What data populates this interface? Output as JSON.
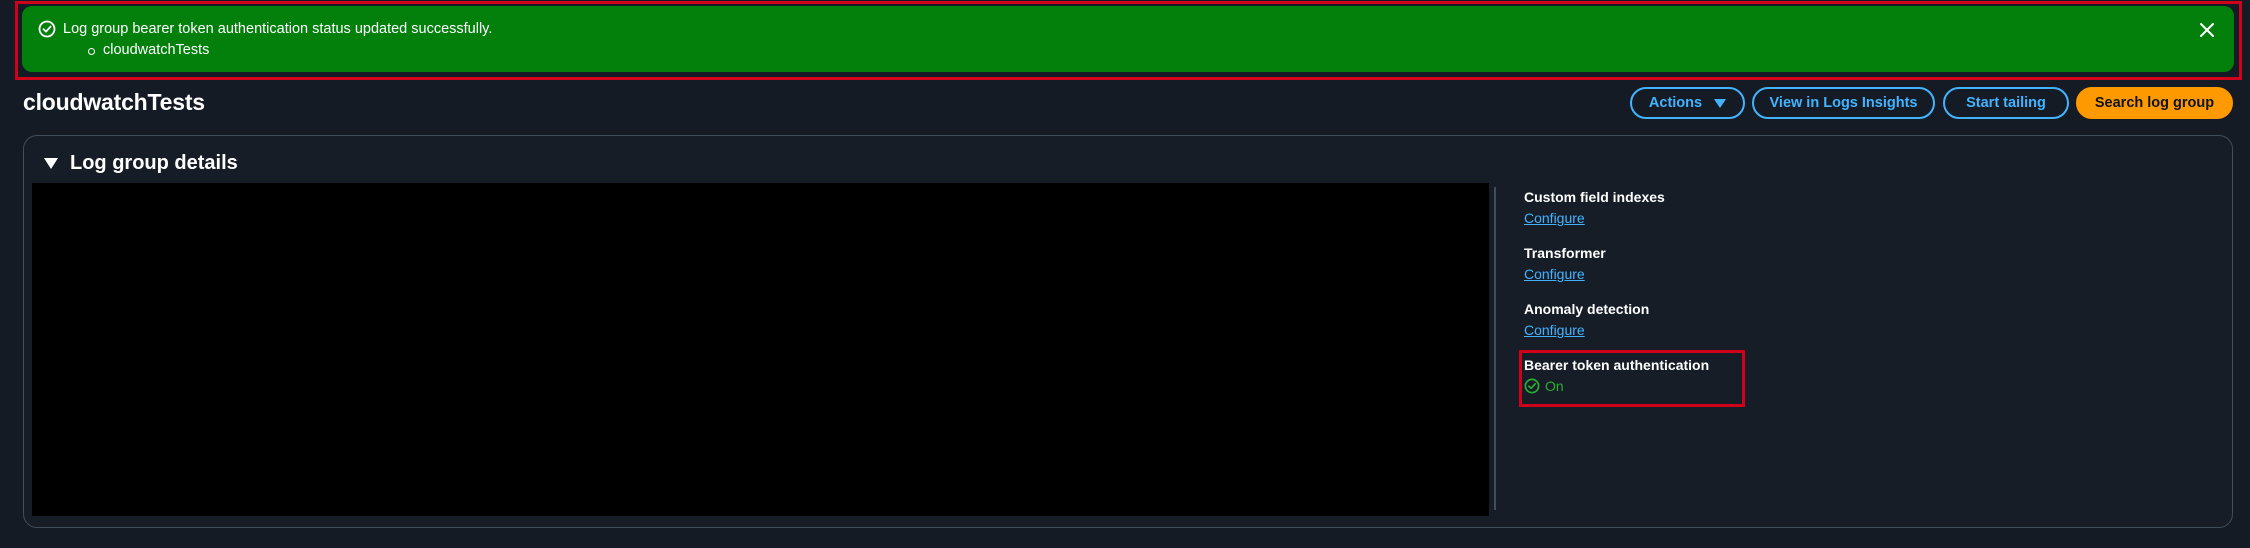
{
  "flash": {
    "message": "Log group bearer token authentication status updated successfully.",
    "items": [
      "cloudwatchTests"
    ]
  },
  "header": {
    "title": "cloudwatchTests",
    "actions_label": "Actions",
    "insights_label": "View in Logs Insights",
    "tailing_label": "Start tailing",
    "search_label": "Search log group"
  },
  "details": {
    "title": "Log group details",
    "fields": [
      {
        "label": "Custom field indexes",
        "value": "Configure"
      },
      {
        "label": "Transformer",
        "value": "Configure"
      },
      {
        "label": "Anomaly detection",
        "value": "Configure"
      },
      {
        "label": "Bearer token authentication",
        "value": "On"
      }
    ]
  },
  "colors": {
    "flash_success": "#037f0c",
    "link": "#42b4ff",
    "primary_button": "#ff9900",
    "status_success": "#29ad32",
    "highlight": "#d0021b"
  }
}
